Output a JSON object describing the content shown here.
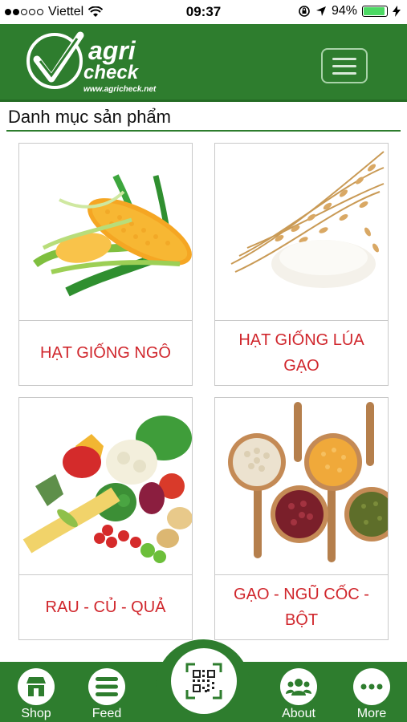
{
  "status": {
    "carrier": "Viettel",
    "time": "09:37",
    "battery": "94%"
  },
  "header": {
    "logo_line1": "agri",
    "logo_line2": "check",
    "logo_url": "www.agricheck.net"
  },
  "section": {
    "title": "Danh mục sản phẩm"
  },
  "categories": [
    {
      "label": "HẠT GIỐNG NGÔ",
      "image": "corn"
    },
    {
      "label": "HẠT GIỐNG LÚA GẠO",
      "image": "rice"
    },
    {
      "label": "RAU - CỦ - QUẢ",
      "image": "vegetables"
    },
    {
      "label": "GẠO - NGŨ CỐC - BỘT",
      "image": "grains-spoons"
    }
  ],
  "tabbar": {
    "shop": "Shop",
    "feed": "Feed",
    "about": "About",
    "more": "More",
    "center_icon": "qr-code-icon"
  },
  "colors": {
    "brand_green": "#2e7d2e",
    "label_red": "#d0262c"
  }
}
